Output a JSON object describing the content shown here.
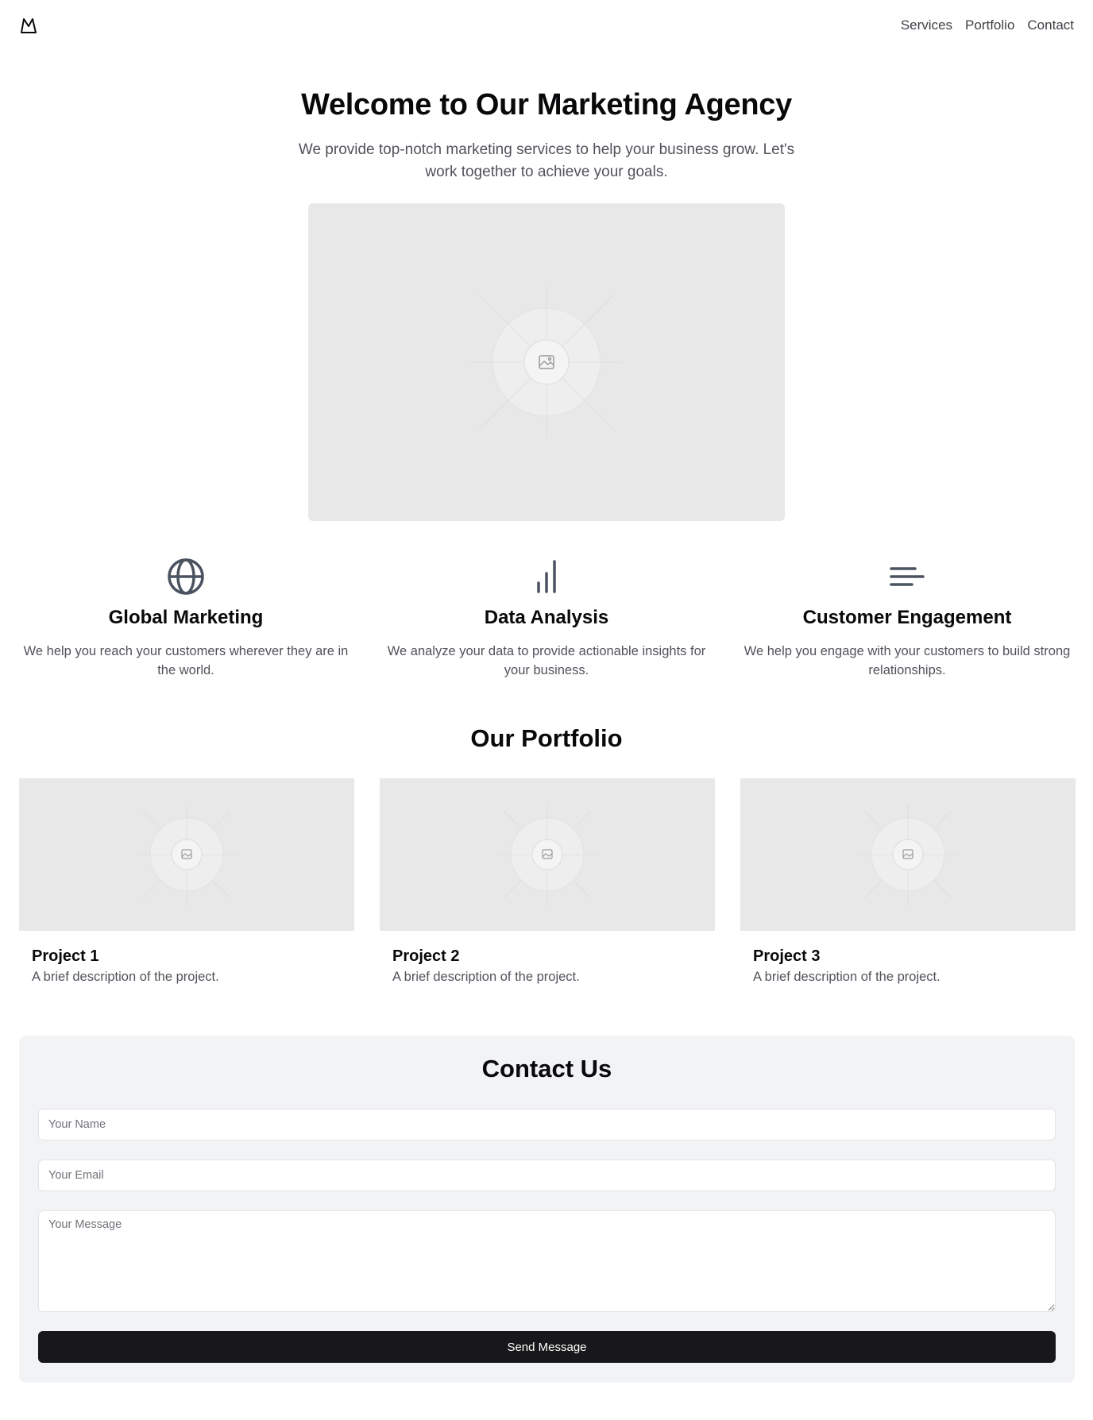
{
  "header": {
    "logo_icon": "mountain-icon",
    "nav": [
      "Services",
      "Portfolio",
      "Contact"
    ]
  },
  "hero": {
    "title": "Welcome to Our Marketing Agency",
    "subtitle": "We provide top-notch marketing services to help your business grow. Let's work together to achieve your goals.",
    "image_icon": "image-placeholder-icon"
  },
  "features": [
    {
      "icon": "globe-icon",
      "title": "Global Marketing",
      "text": "We help you reach your customers wherever they are in the world."
    },
    {
      "icon": "bar-chart-icon",
      "title": "Data Analysis",
      "text": "We analyze your data to provide actionable insights for your business."
    },
    {
      "icon": "align-left-icon",
      "title": "Customer Engagement",
      "text": "We help you engage with your customers to build strong relationships."
    }
  ],
  "portfolio": {
    "title": "Our Portfolio",
    "projects": [
      {
        "title": "Project 1",
        "description": "A brief description of the project."
      },
      {
        "title": "Project 2",
        "description": "A brief description of the project."
      },
      {
        "title": "Project 3",
        "description": "A brief description of the project."
      }
    ]
  },
  "contact": {
    "title": "Contact Us",
    "name_placeholder": "Your Name",
    "email_placeholder": "Your Email",
    "message_placeholder": "Your Message",
    "submit_label": "Send Message"
  },
  "colors": {
    "primary_button": "#18181b",
    "placeholder_bg": "#e8e8e8",
    "contact_bg": "#f2f3f5",
    "muted_text": "#52525b"
  }
}
